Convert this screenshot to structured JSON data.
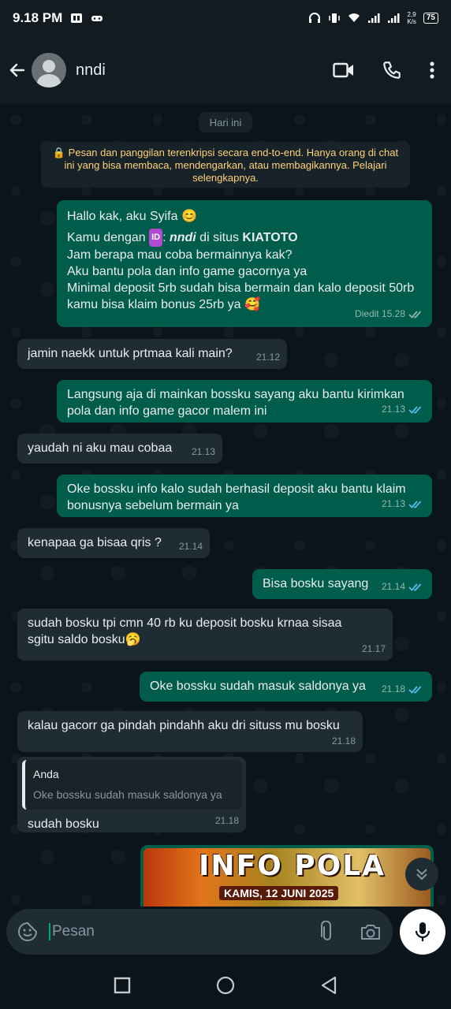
{
  "status_bar": {
    "time": "9.18 PM",
    "net_speed": "2,9\nK/s",
    "net_speed_top": "2,9",
    "net_speed_unit": "K/s",
    "battery": "75"
  },
  "header": {
    "contact_name": "nndi"
  },
  "chat": {
    "date_chip": "Hari ini",
    "encryption_notice": "🔒 Pesan dan panggilan terenkripsi secara end-to-end. Hanya orang di chat ini yang bisa membaca, mendengarkan, atau membagikannya. Pelajari selengkapnya.",
    "messages": [
      {
        "direction": "out",
        "line1": "Hallo kak, aku Syifa 😊",
        "line2_pre": "Kamu dengan ",
        "line2_badge": "ID",
        "line2_mid": ": ",
        "line2_user": "nndi",
        "line2_mid2": " di situs ",
        "line2_site": "KIATOTO",
        "line3": "Jam berapa mau coba bermainnya kak?",
        "line4": "Aku bantu pola dan info game gacornya ya",
        "line5": "Minimal deposit 5rb sudah bisa bermain dan kalo deposit 50rb kamu bisa klaim bonus 25rb ya 🥰",
        "time": "Diedit  15.28"
      },
      {
        "direction": "in",
        "text": "jamin naekk untuk prtmaa kali main?",
        "time": "21.12"
      },
      {
        "direction": "out",
        "text": "Langsung aja di mainkan bossku sayang aku bantu kirimkan pola dan info game gacor malem ini",
        "time": "21.13"
      },
      {
        "direction": "in",
        "text": "yaudah ni aku mau cobaa",
        "time": "21.13"
      },
      {
        "direction": "out",
        "text": "Oke bossku info kalo sudah berhasil deposit aku bantu klaim bonusnya sebelum bermain ya",
        "time": "21.13"
      },
      {
        "direction": "in",
        "text": "kenapaa ga bisaa qris ?",
        "time": "21.14"
      },
      {
        "direction": "out",
        "text": "Bisa bosku sayang",
        "time": "21.14"
      },
      {
        "direction": "in",
        "text": "sudah bosku tpi cmn 40 rb ku deposit bosku krnaa sisaa sgitu saldo bosku🥱",
        "time": "21.17"
      },
      {
        "direction": "out",
        "text": "Oke bossku sudah masuk saldonya ya",
        "time": "21.18"
      },
      {
        "direction": "in",
        "text": "kalau gacorr ga pindah pindahh aku dri situss mu bosku",
        "time": "21.18"
      },
      {
        "direction": "in",
        "quote_author": "Anda",
        "quote_text": "Oke bossku sudah masuk saldonya ya",
        "text": "sudah bosku",
        "time": "21.18"
      }
    ],
    "image_message": {
      "title": "INFO POLA",
      "subtitle": "KAMIS, 12 JUNI 2025"
    }
  },
  "input": {
    "placeholder": "Pesan"
  },
  "colors": {
    "outgoing_bubble": "#005c4b",
    "incoming_bubble": "#202c33",
    "read_ticks": "#53bdeb",
    "accent": "#00a884"
  },
  "icons": [
    "back-arrow-icon",
    "video-call-icon",
    "phone-icon",
    "more-vert-icon",
    "lock-icon",
    "double-check-icon",
    "sticker-icon",
    "attach-icon",
    "camera-icon",
    "mic-icon",
    "scroll-down-icon",
    "nav-recent-icon",
    "nav-home-icon",
    "nav-back-icon"
  ]
}
